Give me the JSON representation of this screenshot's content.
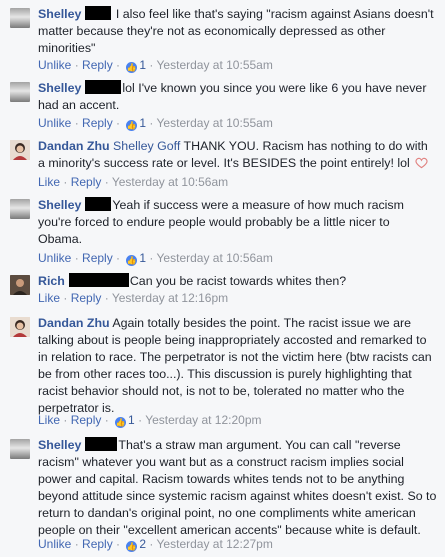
{
  "actions": {
    "unlike": "Unlike",
    "like": "Like",
    "reply": "Reply",
    "sep": " · "
  },
  "comments": [
    {
      "name": "Shelley",
      "text": "I also feel like that's saying \"racism against Asians doesn't matter because they're not as economically depressed as other minorities\"",
      "action": "Unlike",
      "likes": "1",
      "time": "Yesterday at 10:55am"
    },
    {
      "name": "Shelley",
      "text": "lol I've known you since you were like 6 you have never had an accent.",
      "action": "Unlike",
      "likes": "1",
      "time": "Yesterday at 10:55am"
    },
    {
      "name": "Dandan Zhu",
      "mention": "Shelley Goff",
      "text": " THANK YOU. Racism has nothing to do with a minority's success rate or level. It's BESIDES the point entirely! lol",
      "action": "Like",
      "time": "Yesterday at 10:56am"
    },
    {
      "name": "Shelley",
      "text": "Yeah if success were a measure of how much racism you're forced to endure people would probably be a little nicer to Obama.",
      "action": "Unlike",
      "likes": "1",
      "time": "Yesterday at 10:56am"
    },
    {
      "name": "Rich",
      "text": "Can you be racist towards whites then?",
      "action": "Like",
      "time": "Yesterday at 12:16pm"
    },
    {
      "name": "Dandan Zhu",
      "text": "Again totally besides the point. The racist issue we are talking about is people being inappropriately accosted and remarked to in relation to race. The perpetrator is not the victim here (btw racists can be from other races too...). This discussion is purely highlighting that racist behavior should not, is not to be, tolerated no matter who the perpetrator is.",
      "action": "Like",
      "likes": "1",
      "time": "Yesterday at 12:20pm"
    },
    {
      "name": "Shelley",
      "text": "That's a straw man argument. You can call \"reverse racism\" whatever you want but as a construct racism implies social power and capital. Racism towards whites tends not to be anything beyond attitude since systemic racism against whites doesn't exist. So to return to dandan's original point, no one compliments white american people on their \"excellent american accents\" because white is default.",
      "action": "Unlike",
      "likes": "2",
      "time": "Yesterday at 12:27pm"
    }
  ],
  "icons": {
    "like": "thumbs-up-icon",
    "heart": "heart-icon"
  }
}
